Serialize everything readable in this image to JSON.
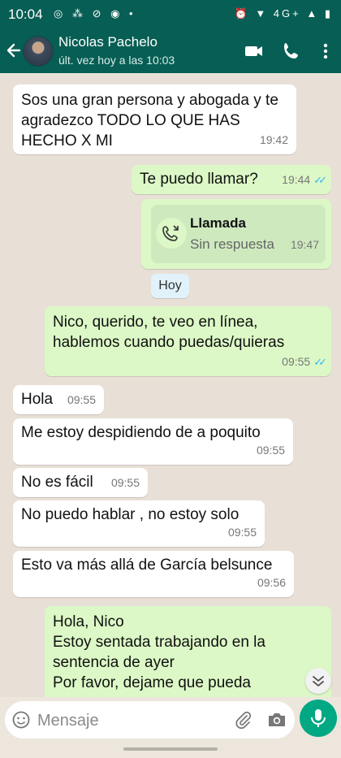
{
  "statusbar": {
    "time": "10:04",
    "notifs": "◎ ⁂ ⊘ ◉ •",
    "sysicons": "⏰ ▼ 4G+ ▲ ▮"
  },
  "header": {
    "contact_name": "Nicolas Pachelo",
    "last_seen": "últ. vez hoy a las 10:03"
  },
  "messages": [
    {
      "dir": "in",
      "text": "Sos una gran persona y abogada y te agradezco TODO LO QUE HAS HECHO X MI",
      "time": "19:42"
    },
    {
      "dir": "out",
      "text": "Te puedo llamar?",
      "time": "19:44",
      "ticks": "✓✓"
    },
    {
      "dir": "in",
      "text": "Hola",
      "time": "09:55"
    },
    {
      "dir": "in",
      "text": "Me estoy despidiendo de a poquito",
      "time": "09:55"
    },
    {
      "dir": "in",
      "text": "No es fácil",
      "time": "09:55"
    },
    {
      "dir": "in",
      "text": "No puedo hablar , no estoy solo",
      "time": "09:55"
    },
    {
      "dir": "in",
      "text": "Esto va más allá de García belsunce",
      "time": "09:56"
    },
    {
      "dir": "out",
      "text": "Nico, querido, te veo en línea, hablemos cuando puedas/quieras",
      "time": "09:55",
      "ticks": "✓✓"
    },
    {
      "dir": "out",
      "text": "Hola, Nico\nEstoy sentada trabajando en la sentencia de ayer\nPor favor, dejame que pueda"
    }
  ],
  "call": {
    "title": "Llamada",
    "status": "Sin respuesta",
    "time": "19:47"
  },
  "date_divider": "Hoy",
  "composer": {
    "placeholder": "Mensaje"
  },
  "colors": {
    "header": "#075e54",
    "outgoing_bubble": "#dcf8c6",
    "incoming_bubble": "#ffffff",
    "read_ticks": "#34b7f1",
    "mic_button": "#00a884"
  }
}
